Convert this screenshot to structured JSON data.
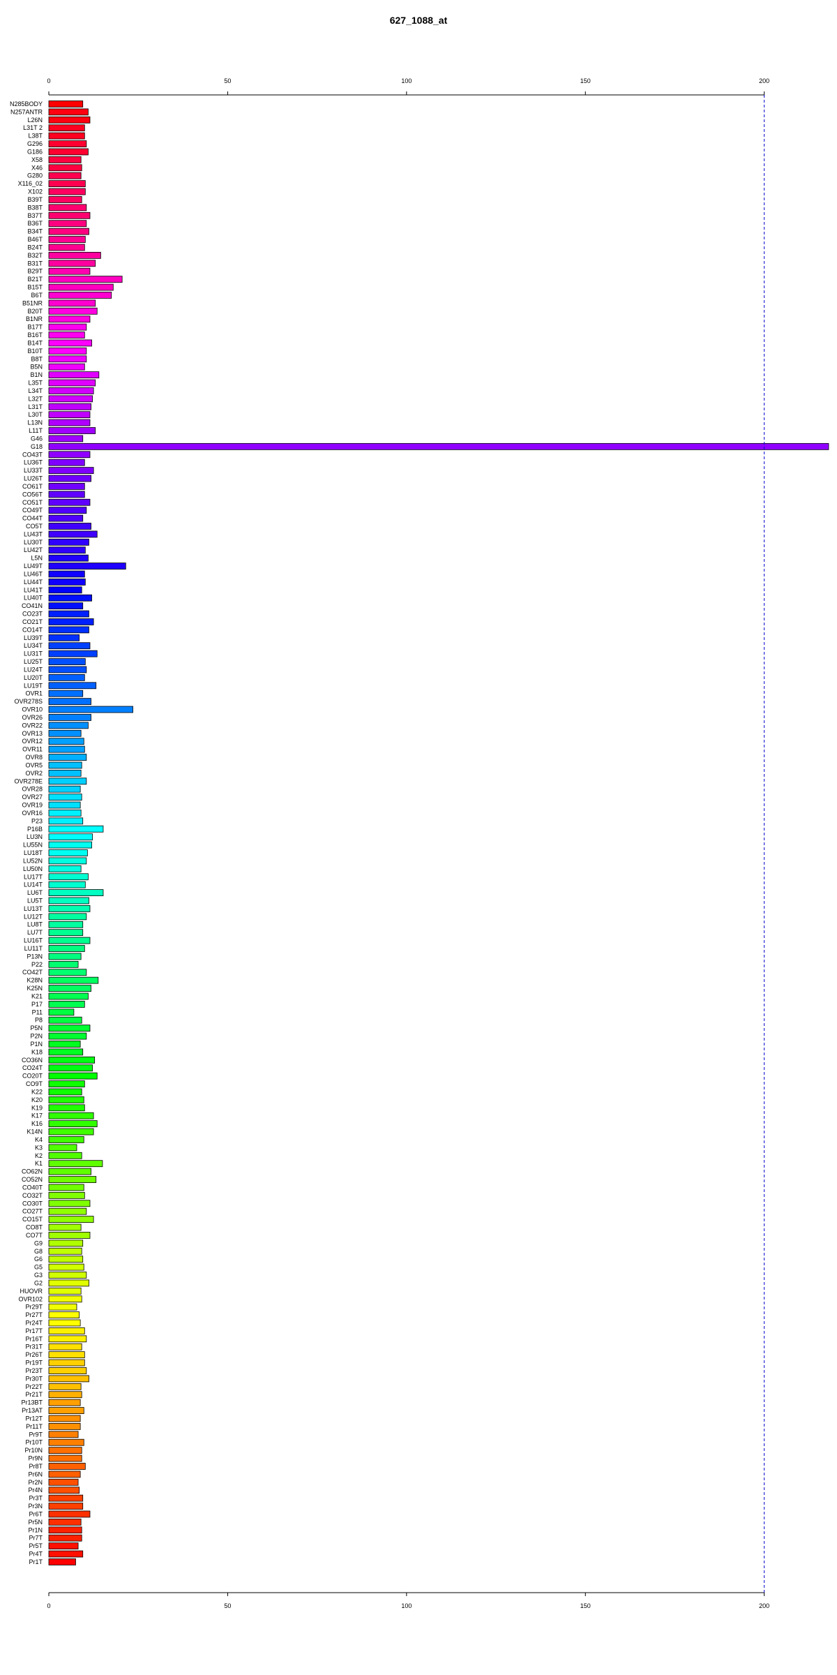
{
  "chart_data": {
    "type": "bar",
    "orientation": "horizontal",
    "title": "627_1088_at",
    "xlim": [
      0,
      218
    ],
    "xticks": [
      0,
      50,
      100,
      150,
      200
    ],
    "reference_line": 200,
    "reference_line_color": "#0000CC",
    "categories": [
      "N285BODY",
      "N257ANTR",
      "L26N",
      "L31T 2",
      "L38T",
      "G296",
      "G186",
      "X58",
      "X46",
      "G280",
      "X116_02",
      "X102",
      "B39T",
      "B38T",
      "B37T",
      "B36T",
      "B34T",
      "B46T",
      "B24T",
      "B32T",
      "B31T",
      "B29T",
      "B21T",
      "B15T",
      "B6T",
      "B51NR",
      "B20T",
      "B1NR",
      "B17T",
      "B16T",
      "B14T",
      "B10T",
      "B8T",
      "B5N",
      "B1N",
      "L35T",
      "L34T",
      "L32T",
      "L31T",
      "L30T",
      "L13N",
      "L11T",
      "G46",
      "G18",
      "CO43T",
      "LU36T",
      "LU33T",
      "LU26T",
      "CO61T",
      "CO56T",
      "CO51T",
      "CO49T",
      "CO44T",
      "CO5T",
      "LU43T",
      "LU30T",
      "LU42T",
      "L5N",
      "LU49T",
      "LU46T",
      "LU44T",
      "LU41T",
      "LU40T",
      "CO41N",
      "CO23T",
      "CO21T",
      "CO14T",
      "LU39T",
      "LU34T",
      "LU31T",
      "LU25T",
      "LU24T",
      "LU20T",
      "LU19T",
      "OVR1",
      "OVR278S",
      "OVR10",
      "OVR26",
      "OVR22",
      "OVR13",
      "OVR12",
      "OVR11",
      "OVR8",
      "OVR5",
      "OVR2",
      "OVR278E",
      "OVR28",
      "OVR27",
      "OVR19",
      "OVR16",
      "P23",
      "P16B",
      "LU3N",
      "LU55N",
      "LU18T",
      "LU52N",
      "LU50N",
      "LU17T",
      "LU14T",
      "LU6T",
      "LU5T",
      "LU13T",
      "LU12T",
      "LU8T",
      "LU7T",
      "LU16T",
      "LU11T",
      "P13N",
      "P22",
      "CO42T",
      "K28N",
      "K25N",
      "K21",
      "P17",
      "P11",
      "P8",
      "P5N",
      "P2N",
      "P1N",
      "K18",
      "CO36N",
      "CO24T",
      "CO20T",
      "CO9T",
      "K22",
      "K20",
      "K19",
      "K17",
      "K16",
      "K14N",
      "K4",
      "K3",
      "K2",
      "K1",
      "CO62N",
      "CO52N",
      "CO40T",
      "CO32T",
      "CO30T",
      "CO27T",
      "CO15T",
      "CO8T",
      "CO7T",
      "G9",
      "G8",
      "G6",
      "G5",
      "G3",
      "G2",
      "HUOVR",
      "OVR102",
      "Pr29T",
      "Pr27T",
      "Pr24T",
      "Pr17T",
      "Pr16T",
      "Pr31T",
      "Pr26T",
      "Pr19T",
      "Pr23T",
      "Pr30T",
      "Pr22T",
      "Pr21T",
      "Pr13BT",
      "Pr13AT",
      "Pr12T",
      "Pr11T",
      "Pr9T",
      "Pr10T",
      "Pr10N",
      "Pr9N",
      "Pr8T",
      "Pr6N",
      "Pr2N",
      "Pr4N",
      "Pr3T",
      "Pr3N",
      "Pr6T",
      "Pr5N",
      "Pr1N",
      "Pr7T",
      "Pr5T",
      "Pr4T",
      "Pr1T"
    ],
    "values": [
      9.5,
      11,
      11.5,
      10,
      10,
      10.5,
      11,
      9,
      9.2,
      9,
      10.2,
      10.2,
      9.2,
      10.5,
      11.5,
      10.5,
      11.2,
      10.2,
      10,
      14.5,
      13,
      11.5,
      20.5,
      18,
      17.5,
      13,
      13.5,
      11.5,
      10.5,
      10,
      12,
      10.5,
      10.5,
      10,
      14,
      13,
      12.5,
      12.2,
      11.8,
      11.5,
      11.5,
      13,
      9.5,
      218,
      11.5,
      10,
      12.5,
      11.8,
      10,
      10,
      11.5,
      10.5,
      9.5,
      11.8,
      13.5,
      11.2,
      10.2,
      11,
      21.5,
      10,
      10.2,
      9.2,
      12,
      9.5,
      11.2,
      12.5,
      11.2,
      8.5,
      11.5,
      13.5,
      10.2,
      10.5,
      10,
      13.2,
      9.5,
      11.8,
      23.5,
      11.8,
      11,
      9,
      9.8,
      10,
      10.5,
      9.2,
      9,
      10.5,
      8.8,
      9.2,
      8.8,
      9,
      9.5,
      15.2,
      12.2,
      12,
      10.8,
      10.5,
      9,
      11,
      10.2,
      15.2,
      11.2,
      11.5,
      10.5,
      9.5,
      9.5,
      11.5,
      10,
      9,
      8.2,
      10.5,
      13.8,
      11.8,
      11,
      10,
      7,
      9.2,
      11.5,
      10.5,
      8.8,
      9.5,
      12.8,
      12.2,
      13.5,
      10,
      9.2,
      9.8,
      10,
      12.5,
      13.5,
      12.5,
      9.8,
      7.8,
      9.2,
      15,
      11.8,
      13.2,
      9.8,
      10,
      11.5,
      10.5,
      12.5,
      9,
      11.5,
      9.5,
      9.2,
      9.5,
      9.8,
      10.5,
      11.2,
      9,
      9.2,
      7.8,
      8.5,
      8.8,
      10,
      10.5,
      9.2,
      10,
      10,
      10.5,
      11.2,
      9,
      9.2,
      8.8,
      9.8,
      8.8,
      8.8,
      8.2,
      9.8,
      9.2,
      9.2,
      10.2,
      8.8,
      8.2,
      8.5,
      9.5,
      9.5,
      11.5,
      9,
      9.2,
      9.2,
      8.2,
      9.5,
      7.5
    ],
    "colors": [
      "#FF0000",
      "#FF0010",
      "#FF0020",
      "#FF0030",
      "#FF0040",
      "#FF0050",
      "#FF0060",
      "#FF0070",
      "#FF0080",
      "#FF0090",
      "#FF00A0",
      "#FF00B0",
      "#FF00C0",
      "#FF00D0",
      "#FF00E0",
      "#FF00F0",
      "#FF00FF",
      "#F000FF",
      "#E000FF",
      "#D000FF",
      "#C000FF",
      "#B000FF",
      "#A000FF",
      "#9000FF",
      "#8000FF",
      "#7000FF",
      "#6000FF",
      "#5000FF",
      "#4000FF",
      "#3000FF",
      "#2000FF",
      "#1000FF",
      "#0000FF",
      "#0010FF",
      "#0020FF",
      "#0030FF",
      "#0040FF",
      "#0050FF",
      "#0060FF",
      "#0070FF",
      "#0080FF",
      "#0090FF",
      "#00A0FF",
      "#00B0FF",
      "#00C0FF",
      "#00D0FF",
      "#00E0FF",
      "#00F0FF",
      "#00FFFF",
      "#00FFF0",
      "#00FFE0",
      "#00FFD0",
      "#00FFC0",
      "#00FFB0",
      "#00FFA0",
      "#00FF90",
      "#00FF80",
      "#00FF70",
      "#00FF60",
      "#00FF50",
      "#00FF40",
      "#00FF30",
      "#00FF20",
      "#00FF10",
      "#00FF00",
      "#10FF00",
      "#20FF00",
      "#30FF00",
      "#40FF00",
      "#50FF00",
      "#60FF00",
      "#70FF00",
      "#80FF00",
      "#90FF00",
      "#A0FF00",
      "#B0FF00",
      "#C0FF00",
      "#D0FF00",
      "#E0FF00",
      "#F0FF00",
      "#FFFF00",
      "#FFF000",
      "#FFE000",
      "#FFD000",
      "#FFC000",
      "#FFB000",
      "#FFA000",
      "#FF9000",
      "#FF8000",
      "#FF7000",
      "#FF6000",
      "#FF5000",
      "#FF4000",
      "#FF3000",
      "#FF2000",
      "#FF1000",
      "#FF0000"
    ]
  }
}
